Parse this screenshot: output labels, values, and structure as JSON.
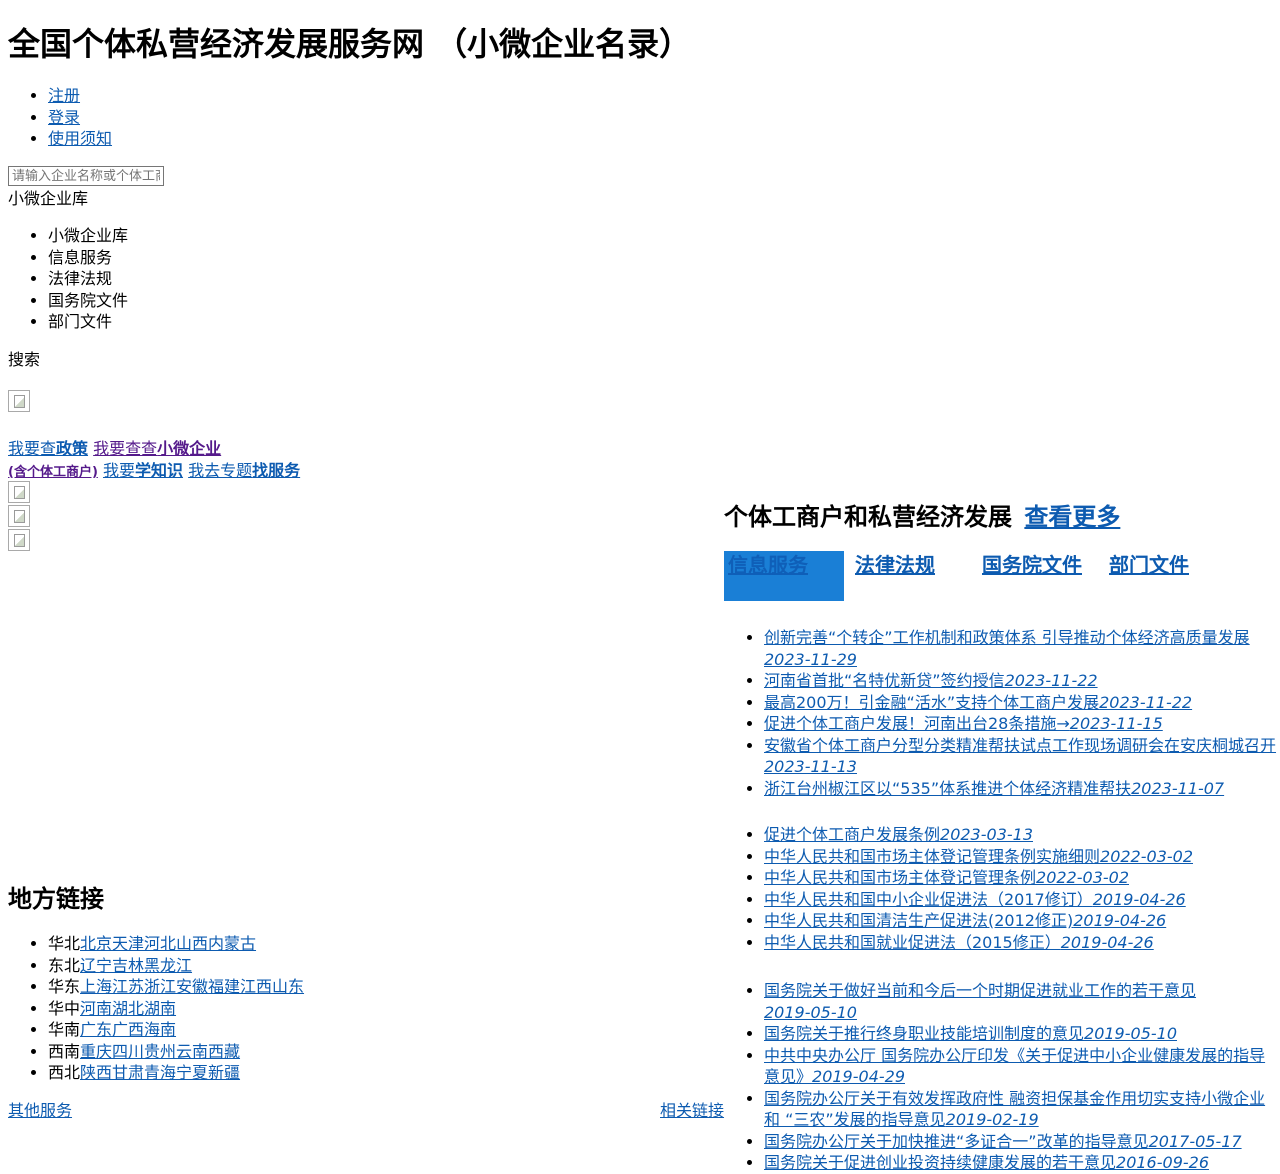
{
  "site_title": "全国个体私营经济发展服务网 （小微企业名录）",
  "top_links": [
    "注册",
    "登录",
    "使用须知"
  ],
  "search": {
    "placeholder": "请输入企业名称或个体工商户名称",
    "library_label": "小微企业库",
    "button_label": "搜索"
  },
  "categories": [
    "小微企业库",
    "信息服务",
    "法律法规",
    "国务院文件",
    "部门文件"
  ],
  "quick_links": {
    "policy_prefix": "我要查",
    "policy_bold": "政策",
    "company_prefix": "我要查查",
    "company_bold": "小微企业",
    "company_note": "(含个体工商户)",
    "learn_prefix": "我要",
    "learn_bold": "学知识",
    "service_prefix": "我去专题",
    "service_bold": "找服务"
  },
  "section": {
    "title": "个体工商户和私营经济发展",
    "more": "查看更多"
  },
  "tabs": [
    "信息服务",
    "法律法规",
    "国务院文件",
    "部门文件"
  ],
  "news_info": [
    {
      "title": "创新完善“个转企”工作机制和政策体系 引导推动个体经济高质量发展",
      "date": "2023-11-29"
    },
    {
      "title": "河南省首批“名特优新贷”签约授信",
      "date": "2023-11-22"
    },
    {
      "title": "最高200万！引金融“活水”支持个体工商户发展",
      "date": "2023-11-22"
    },
    {
      "title": "促进个体工商户发展！河南出台28条措施→",
      "date": "2023-11-15"
    },
    {
      "title": "安徽省个体工商户分型分类精准帮扶试点工作现场调研会在安庆桐城召开",
      "date": "2023-11-13"
    },
    {
      "title": "浙江台州椒江区以“535”体系推进个体经济精准帮扶",
      "date": "2023-11-07"
    }
  ],
  "news_law": [
    {
      "title": "促进个体工商户发展条例",
      "date": "2023-03-13"
    },
    {
      "title": "中华人民共和国市场主体登记管理条例实施细则",
      "date": "2022-03-02"
    },
    {
      "title": "中华人民共和国市场主体登记管理条例",
      "date": "2022-03-02"
    },
    {
      "title": "中华人民共和国中小企业促进法（2017修订）",
      "date": "2019-04-26"
    },
    {
      "title": "中华人民共和国清洁生产促进法(2012修正)",
      "date": "2019-04-26"
    },
    {
      "title": "中华人民共和国就业促进法（2015修正）",
      "date": "2019-04-26"
    }
  ],
  "news_council": [
    {
      "title": "国务院关于做好当前和今后一个时期促进就业工作的若干意见",
      "date": "2019-05-10"
    },
    {
      "title": "国务院关于推行终身职业技能培训制度的意见",
      "date": "2019-05-10"
    },
    {
      "title": "中共中央办公厅 国务院办公厅印发《关于促进中小企业健康发展的指导意见》",
      "date": "2019-04-29"
    },
    {
      "title": "国务院办公厅关于有效发挥政府性 融资担保基金作用切实支持小微企业和 “三农”发展的指导意见",
      "date": "2019-02-19"
    },
    {
      "title": "国务院办公厅关于加快推进“多证合一”改革的指导意见",
      "date": "2017-05-17"
    },
    {
      "title": "国务院关于促进创业投资持续健康发展的若干意见",
      "date": "2016-09-26"
    }
  ],
  "region_title": "地方链接",
  "regions": [
    {
      "area": "华北",
      "places": "北京天津河北山西内蒙古"
    },
    {
      "area": "东北",
      "places": "辽宁吉林黑龙江"
    },
    {
      "area": "华东",
      "places": "上海江苏浙江安徽福建江西山东"
    },
    {
      "area": "华中",
      "places": "河南湖北湖南"
    },
    {
      "area": "华南",
      "places": "广东广西海南"
    },
    {
      "area": "西南",
      "places": "重庆四川贵州云南西藏"
    },
    {
      "area": "西北",
      "places": "陕西甘肃青海宁夏新疆"
    }
  ],
  "footer": {
    "other": "其他服务",
    "related": "相关链接"
  }
}
